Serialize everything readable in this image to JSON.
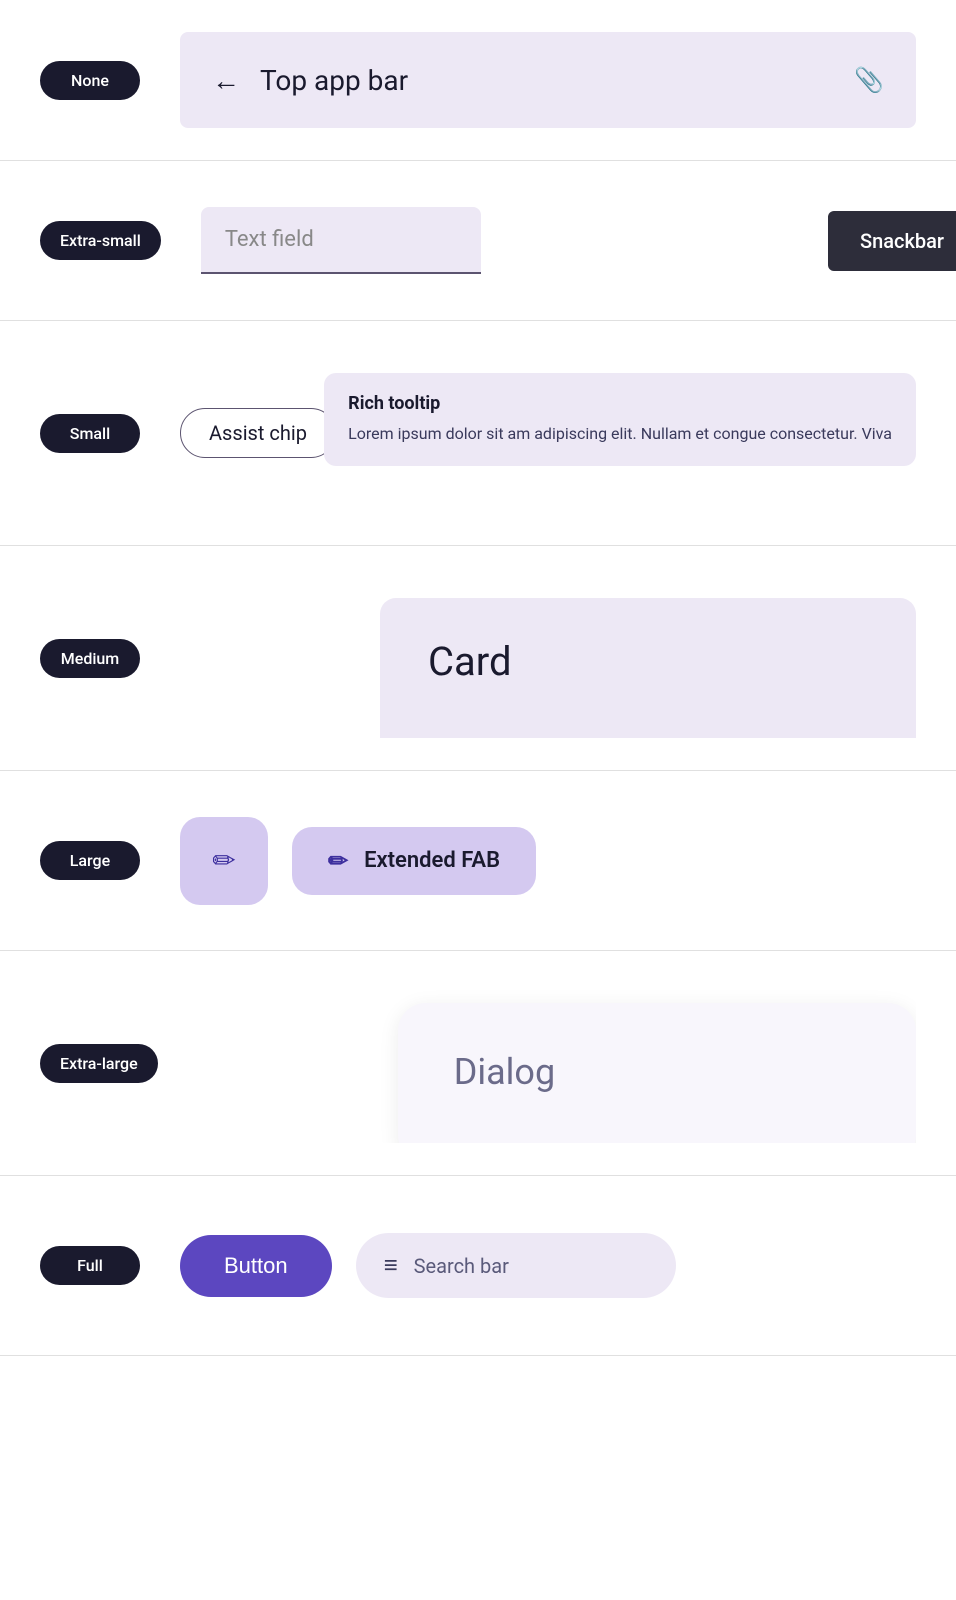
{
  "rows": [
    {
      "id": "none",
      "badge": "None",
      "content_type": "top-app-bar",
      "top_app_bar": {
        "title": "Top app bar",
        "back_label": "←",
        "clip_label": "📎"
      }
    },
    {
      "id": "extra-small",
      "badge": "Extra-small",
      "content_type": "text-field-snackbar",
      "text_field": {
        "placeholder": "Text field"
      },
      "snackbar": {
        "label": "Snackbar"
      }
    },
    {
      "id": "small",
      "badge": "Small",
      "content_type": "chip-tooltip",
      "chip": {
        "label": "Assist chip"
      },
      "tooltip": {
        "title": "Rich tooltip",
        "body": "Lorem ipsum dolor sit am adipiscing elit. Nullam et congue consectetur. Viva"
      }
    },
    {
      "id": "medium",
      "badge": "Medium",
      "content_type": "card",
      "card": {
        "title": "Card"
      }
    },
    {
      "id": "large",
      "badge": "Large",
      "content_type": "fab",
      "fab": {
        "icon": "✏",
        "extended_label": "Extended FAB",
        "extended_icon": "✏"
      }
    },
    {
      "id": "extra-large",
      "badge": "Extra-large",
      "content_type": "dialog",
      "dialog": {
        "title": "Dialog"
      }
    },
    {
      "id": "full",
      "badge": "Full",
      "content_type": "button-search",
      "button": {
        "label": "Button"
      },
      "search_bar": {
        "placeholder": "Search bar",
        "icon": "≡"
      }
    }
  ]
}
